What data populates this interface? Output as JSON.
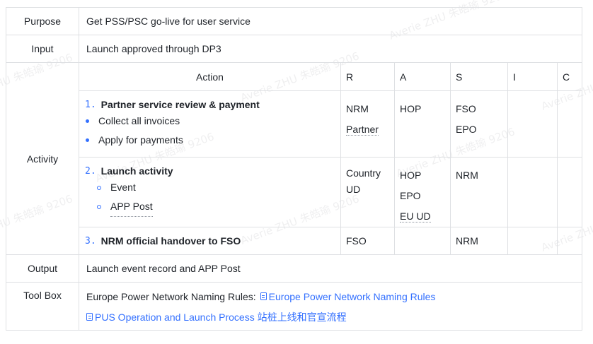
{
  "watermark": "Averie ZHU 朱皓瑜 9206",
  "rows": {
    "purpose": {
      "label": "Purpose",
      "value": "Get PSS/PSC go-live for user service"
    },
    "input": {
      "label": "Input",
      "value": "Launch approved through DP3"
    },
    "activity": {
      "label": "Activity"
    },
    "output": {
      "label": "Output",
      "value": "Launch event record and APP Post"
    },
    "toolbox": {
      "label": "Tool Box",
      "prefix": "Europe Power Network Naming Rules:",
      "link1": "Europe Power Network Naming Rules",
      "link2": "PUS Operation and Launch Process 站桩上线和官宣流程"
    }
  },
  "raci": {
    "headers": {
      "action": "Action",
      "r": "R",
      "a": "A",
      "s": "S",
      "i": "I",
      "c": "C"
    },
    "items": [
      {
        "num": "1.",
        "title": "Partner service review & payment",
        "bullets": [
          "Collect all invoices",
          "Apply for payments"
        ],
        "r": [
          "NRM",
          "Partner"
        ],
        "a": [
          "HOP"
        ],
        "s": [
          "FSO",
          "EPO"
        ]
      },
      {
        "num": "2.",
        "title": "Launch activity",
        "subbullets": [
          "Event",
          "APP Post"
        ],
        "r": [
          "Country UD"
        ],
        "a": [
          "HOP",
          "EPO",
          "EU UD"
        ],
        "s": [
          "NRM"
        ]
      },
      {
        "num": "3.",
        "title": "NRM official handover to FSO",
        "r": [
          "FSO"
        ],
        "s": [
          "NRM"
        ]
      }
    ]
  }
}
